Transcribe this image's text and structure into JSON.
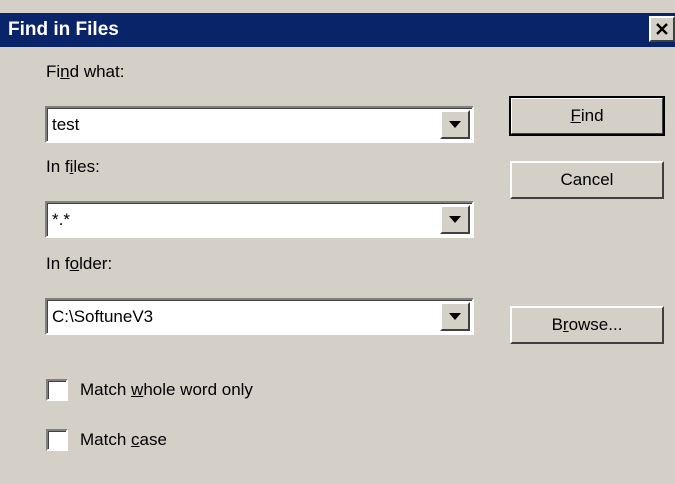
{
  "window": {
    "title": "Find in Files",
    "close_icon": "close-icon"
  },
  "find_what": {
    "label_pre": "Fi",
    "label_underline": "n",
    "label_post": "d what:",
    "value": "test"
  },
  "in_files": {
    "label_pre": "In f",
    "label_underline": "i",
    "label_post": "les:",
    "value": "*.*"
  },
  "in_folder": {
    "label_pre": "In f",
    "label_underline": "o",
    "label_post": "lder:",
    "value": "C:\\SoftuneV3"
  },
  "buttons": {
    "find_underline": "F",
    "find_post": "ind",
    "cancel": "Cancel",
    "browse_pre": "B",
    "browse_underline": "r",
    "browse_post": "owse..."
  },
  "options": {
    "whole_word_pre": "Match ",
    "whole_word_underline": "w",
    "whole_word_post": "hole word only",
    "whole_word_checked": false,
    "match_case_pre": "Match ",
    "match_case_underline": "c",
    "match_case_post": "ase",
    "match_case_checked": false
  },
  "colors": {
    "title_bar": "#0a246a",
    "face": "#d4d0c8"
  }
}
